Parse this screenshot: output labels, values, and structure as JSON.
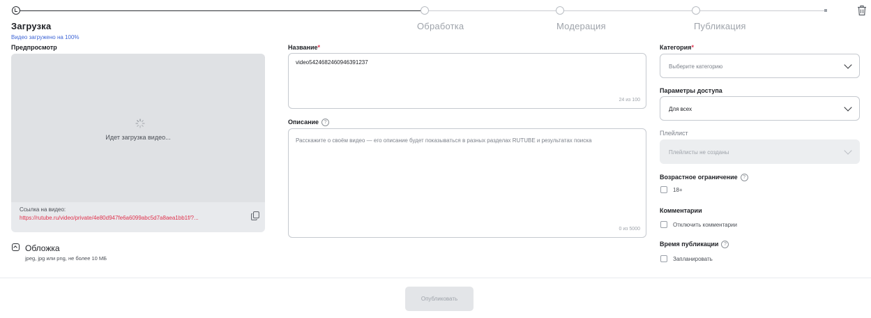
{
  "steps": [
    {
      "label": "Загрузка",
      "state": "active"
    },
    {
      "label": "Обработка",
      "state": "pending"
    },
    {
      "label": "Модерация",
      "state": "pending"
    },
    {
      "label": "Публикация",
      "state": "pending"
    }
  ],
  "upload_progress_text": "Видео загружено на 100%",
  "preview": {
    "title": "Предпросмотр",
    "status": "Идет загрузка видео...",
    "link_label": "Ссылка на видео:",
    "link_url": "https://rutube.ru/video/private/4e80d947fe6a6099abc5d7a8aea1bb1f/?...",
    "copy_icon": "copy-icon"
  },
  "cover": {
    "title": "Обложка",
    "hint": "jpeg, jpg или png, не более 10 МБ"
  },
  "title_field": {
    "label": "Название",
    "required_mark": "*",
    "value": "video5424682460946391237",
    "counter": "24 из 100"
  },
  "description_field": {
    "label": "Описание",
    "help": "?",
    "placeholder": "Расскажите о своём видео — его описание будет показываться в разных разделах RUTUBE и результатах поиска",
    "counter": "0 из 5000"
  },
  "category": {
    "label": "Категория",
    "required_mark": "*",
    "placeholder": "Выберите категорию"
  },
  "access": {
    "label": "Параметры доступа",
    "value": "Для всех"
  },
  "playlist": {
    "label": "Плейлист",
    "placeholder": "Плейлисты не созданы",
    "disabled": true
  },
  "age_restriction": {
    "label": "Возрастное ограничение",
    "help": "?",
    "option": "18+",
    "checked": false
  },
  "comments": {
    "label": "Комментарии",
    "option": "Отключить комментарии",
    "checked": false
  },
  "publish_time": {
    "label": "Время публикации",
    "help": "?",
    "option": "Запланировать",
    "checked": false
  },
  "publish_button": "Опубликовать",
  "colors": {
    "required": "#e0314c",
    "link": "#e0314c",
    "progress_text": "#3f66d6"
  }
}
